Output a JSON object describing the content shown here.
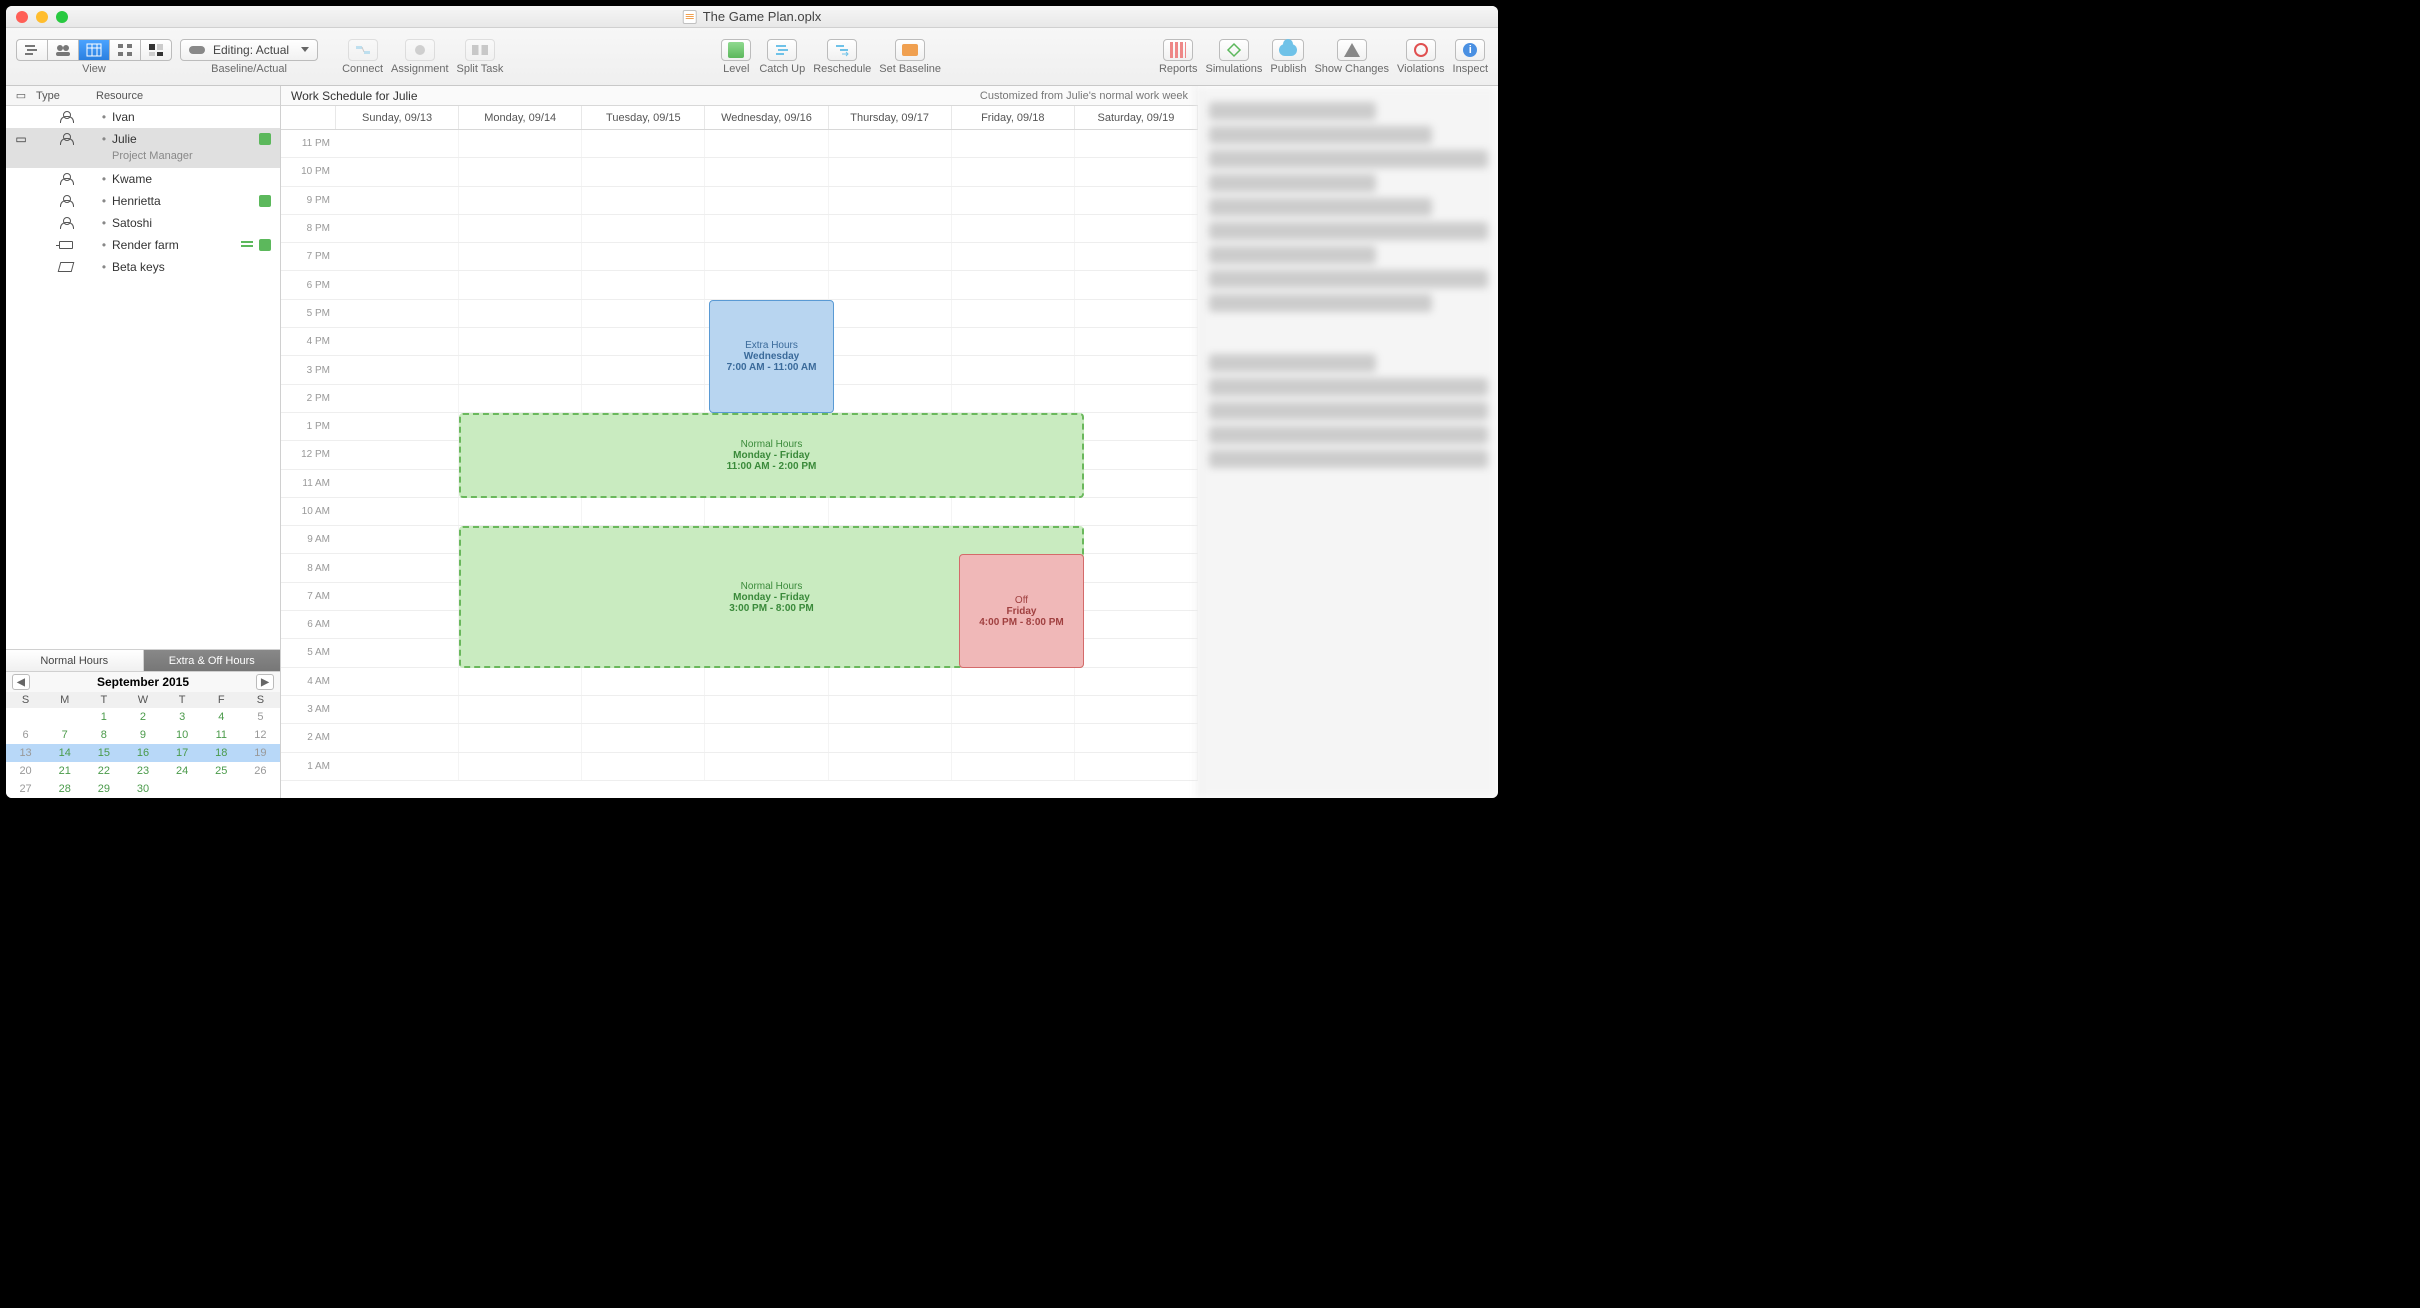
{
  "window": {
    "title": "The Game Plan.oplx"
  },
  "toolbar": {
    "view": "View",
    "baseline_actual": "Baseline/Actual",
    "editing_label": "Editing: Actual",
    "connect": "Connect",
    "assignment": "Assignment",
    "split_task": "Split Task",
    "level": "Level",
    "catch_up": "Catch Up",
    "reschedule": "Reschedule",
    "set_baseline": "Set Baseline",
    "reports": "Reports",
    "simulations": "Simulations",
    "publish": "Publish",
    "show_changes": "Show Changes",
    "violations": "Violations",
    "inspect": "Inspect"
  },
  "sidebar": {
    "col_type": "Type",
    "col_resource": "Resource",
    "resources": [
      {
        "name": "Ivan",
        "kind": "person"
      },
      {
        "name": "Julie",
        "kind": "person",
        "role": "Project Manager",
        "selected": true,
        "puzzle": true
      },
      {
        "name": "Kwame",
        "kind": "person"
      },
      {
        "name": "Henrietta",
        "kind": "person",
        "puzzle": true
      },
      {
        "name": "Satoshi",
        "kind": "person"
      },
      {
        "name": "Render farm",
        "kind": "equipment",
        "bars": true,
        "puzzle": true
      },
      {
        "name": "Beta keys",
        "kind": "material"
      }
    ],
    "tabs": {
      "normal": "Normal Hours",
      "extra": "Extra & Off Hours"
    },
    "calendar": {
      "title": "September 2015",
      "dow": [
        "S",
        "M",
        "T",
        "W",
        "T",
        "F",
        "S"
      ],
      "weeks": [
        [
          "",
          "",
          "1",
          "2",
          "3",
          "4",
          "5"
        ],
        [
          "6",
          "7",
          "8",
          "9",
          "10",
          "11",
          "12"
        ],
        [
          "13",
          "14",
          "15",
          "16",
          "17",
          "18",
          "19"
        ],
        [
          "20",
          "21",
          "22",
          "23",
          "24",
          "25",
          " 26"
        ],
        [
          "27",
          "28",
          "29",
          "30",
          "",
          "",
          ""
        ]
      ],
      "work_cols": [
        1,
        2,
        3,
        4,
        5
      ],
      "highlight_row": 2
    }
  },
  "schedule": {
    "title": "Work Schedule for Julie",
    "subtitle": "Customized from Julie's normal work week",
    "days": [
      "Sunday, 09/13",
      "Monday, 09/14",
      "Tuesday, 09/15",
      "Wednesday, 09/16",
      "Thursday, 09/17",
      "Friday, 09/18",
      "Saturday, 09/19"
    ],
    "hours": [
      "1 AM",
      "2 AM",
      "3 AM",
      "4 AM",
      "5 AM",
      "6 AM",
      "7 AM",
      "8 AM",
      "9 AM",
      "10 AM",
      "11 AM",
      "12 PM",
      "1 PM",
      "2 PM",
      "3 PM",
      "4 PM",
      "5 PM",
      "6 PM",
      "7 PM",
      "8 PM",
      "9 PM",
      "10 PM",
      "11 PM"
    ],
    "blocks": {
      "extra": {
        "label": "Extra Hours",
        "day": "Wednesday",
        "time": "7:00 AM - 11:00 AM"
      },
      "normal1": {
        "label": "Normal Hours",
        "day": "Monday - Friday",
        "time": "11:00 AM - 2:00 PM"
      },
      "normal2": {
        "label": "Normal Hours",
        "day": "Monday - Friday",
        "time": "3:00 PM - 8:00 PM"
      },
      "off": {
        "label": "Off",
        "day": "Friday",
        "time": "4:00 PM - 8:00 PM"
      }
    }
  }
}
